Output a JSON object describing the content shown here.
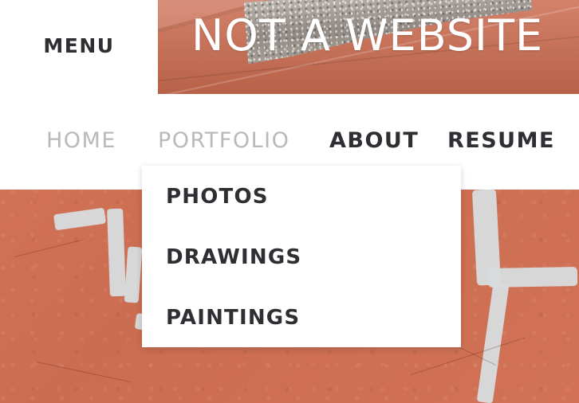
{
  "header": {
    "menu_label": "MENU",
    "site_title": "NOT A WEBSITE"
  },
  "nav": {
    "items": [
      {
        "label": "HOME"
      },
      {
        "label": "PORTFOLIO"
      },
      {
        "label": "ABOUT"
      },
      {
        "label": "RESUME"
      }
    ]
  },
  "dropdown": {
    "items": [
      {
        "label": "PHOTOS"
      },
      {
        "label": "DRAWINGS"
      },
      {
        "label": "PAINTINGS"
      }
    ]
  },
  "colors": {
    "background_accent": "#cf6f52",
    "text_dark": "#2f2f33",
    "text_muted": "#b9b9b9",
    "panel_white": "#ffffff"
  }
}
